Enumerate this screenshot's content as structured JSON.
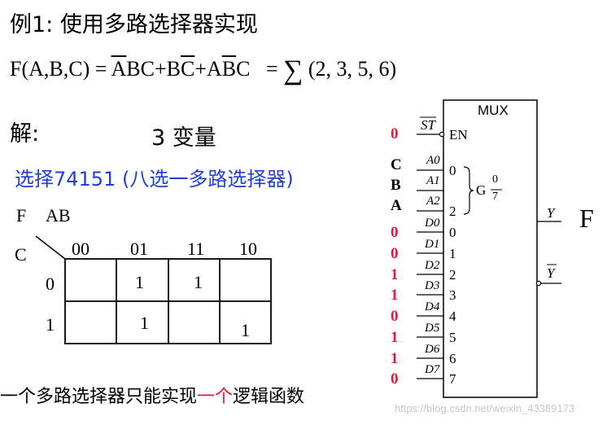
{
  "title": "例1: 使用多路选择器实现",
  "formula": {
    "lhs": "F(A,B,C)",
    "eq": "=",
    "term1_bar": "A",
    "term1_rest": "BC",
    "plus": "+",
    "term2_a": "B",
    "term2_bar": "C",
    "term3_a": "A",
    "term3_bar": "B",
    "term3_c": "C",
    "eq2": "=",
    "sum_symbol": "∑",
    "sum_args": "(2, 3, 5, 6)"
  },
  "solution_label": "解:",
  "variables_label": "3 变量",
  "select_text": "选择74151 (八选一多路选择器)",
  "kmap": {
    "corner_f": "F",
    "corner_ab": "AB",
    "corner_c": "C",
    "col_headers": [
      "00",
      "01",
      "11",
      "10"
    ],
    "row_headers": [
      "0",
      "1"
    ],
    "rows": [
      [
        "",
        "1",
        "1",
        ""
      ],
      [
        "",
        "1",
        "",
        "1"
      ]
    ]
  },
  "bottom_note": {
    "part1": "一个多路选择器只能实现",
    "highlight": "一个",
    "part2": "逻辑函数"
  },
  "mux": {
    "title": "MUX",
    "st_label": "ST",
    "en_label": "EN",
    "select_labels": [
      "A0",
      "A1",
      "A2"
    ],
    "select_inputs": [
      "C",
      "B",
      "A"
    ],
    "select_bracket_top": "0",
    "select_bracket_bottom": "2",
    "g_label": "G",
    "g_frac_num": "0",
    "g_frac_den": "7",
    "st_value": "0",
    "data_labels": [
      "D0",
      "D1",
      "D2",
      "D3",
      "D4",
      "D5",
      "D6",
      "D7"
    ],
    "data_pin_nums": [
      "0",
      "1",
      "2",
      "3",
      "4",
      "5",
      "6",
      "7"
    ],
    "data_values": [
      "0",
      "0",
      "1",
      "1",
      "0",
      "1",
      "1",
      "0"
    ],
    "y_label": "Y",
    "ybar_label": "Y",
    "output_name": "F"
  },
  "watermark": "https://blog.csdn.net/weixin_43389173",
  "colors": {
    "red": "#e8173a",
    "blue": "#1f3fd6"
  }
}
